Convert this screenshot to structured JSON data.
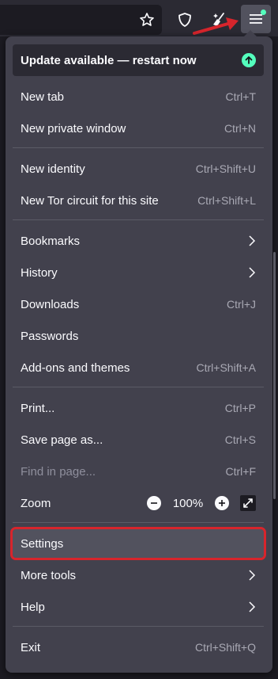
{
  "toolbar": {
    "icons": [
      "star-icon",
      "shield-icon",
      "broom-icon",
      "hamburger-menu-icon"
    ],
    "colors": {
      "badge": "#54ffbd",
      "annotation_arrow": "#d7252c"
    }
  },
  "menu": {
    "update": {
      "label": "Update available — restart now",
      "icon": "arrow-up-circle-icon"
    },
    "new_tab": {
      "label": "New tab",
      "shortcut": "Ctrl+T"
    },
    "new_private_window": {
      "label": "New private window",
      "shortcut": "Ctrl+N"
    },
    "new_identity": {
      "label": "New identity",
      "shortcut": "Ctrl+Shift+U"
    },
    "new_tor_circuit": {
      "label": "New Tor circuit for this site",
      "shortcut": "Ctrl+Shift+L"
    },
    "bookmarks": {
      "label": "Bookmarks"
    },
    "history": {
      "label": "History"
    },
    "downloads": {
      "label": "Downloads",
      "shortcut": "Ctrl+J"
    },
    "passwords": {
      "label": "Passwords"
    },
    "addons": {
      "label": "Add-ons and themes",
      "shortcut": "Ctrl+Shift+A"
    },
    "print": {
      "label": "Print...",
      "shortcut": "Ctrl+P"
    },
    "save_page": {
      "label": "Save page as...",
      "shortcut": "Ctrl+S"
    },
    "find_in_page": {
      "label": "Find in page...",
      "shortcut": "Ctrl+F"
    },
    "zoom": {
      "label": "Zoom",
      "value": "100%"
    },
    "settings": {
      "label": "Settings"
    },
    "more_tools": {
      "label": "More tools"
    },
    "help": {
      "label": "Help"
    },
    "exit": {
      "label": "Exit",
      "shortcut": "Ctrl+Shift+Q"
    }
  },
  "colors": {
    "panel_bg": "#42414d",
    "highlight_outline": "#d7252c",
    "update_accent": "#54ffbd"
  }
}
